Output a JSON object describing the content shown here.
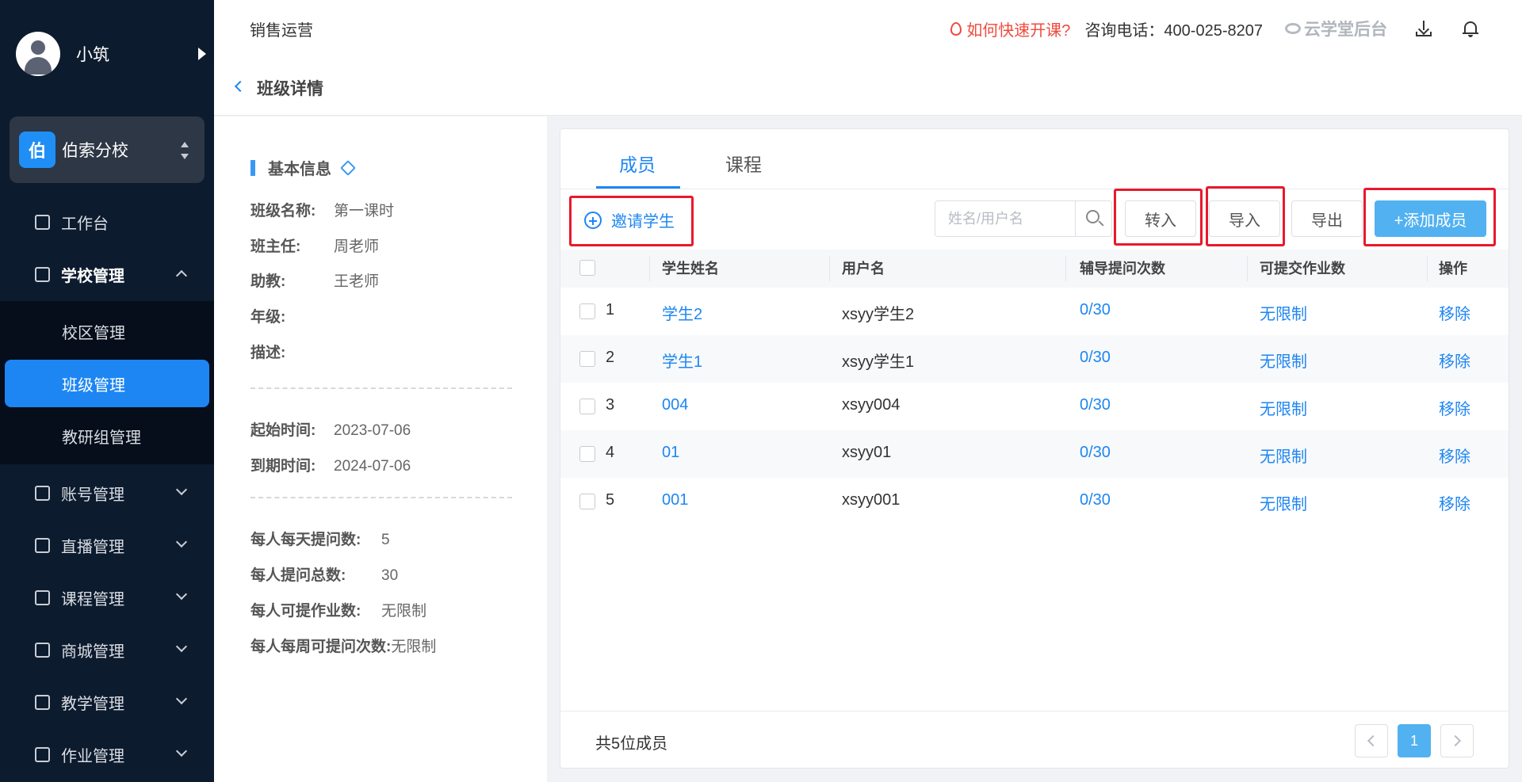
{
  "sidebar": {
    "user_name": "小筑",
    "school_badge": "伯",
    "school_name": "伯索分校",
    "items": [
      {
        "label": "工作台"
      },
      {
        "label": "学校管理"
      },
      {
        "label": "账号管理"
      },
      {
        "label": "直播管理"
      },
      {
        "label": "课程管理"
      },
      {
        "label": "商城管理"
      },
      {
        "label": "教学管理"
      },
      {
        "label": "作业管理"
      }
    ],
    "sub_items": [
      {
        "label": "校区管理"
      },
      {
        "label": "班级管理"
      },
      {
        "label": "教研组管理"
      }
    ],
    "selected_sub": "班级管理"
  },
  "header": {
    "title": "销售运营",
    "help_link": "如何快速开课?",
    "hotline": "咨询电话：400-025-8207",
    "brand": "云学堂后台"
  },
  "breadcrumb": {
    "title": "班级详情"
  },
  "info": {
    "section_title": "基本信息",
    "rows": [
      {
        "label": "班级名称:",
        "value": "第一课时"
      },
      {
        "label": "班主任:",
        "value": "周老师"
      },
      {
        "label": "助教:",
        "value": "王老师"
      },
      {
        "label": "年级:",
        "value": ""
      },
      {
        "label": "描述:",
        "value": ""
      }
    ],
    "dates": [
      {
        "label": "起始时间:",
        "value": "2023-07-06"
      },
      {
        "label": "到期时间:",
        "value": "2024-07-06"
      }
    ],
    "limits": [
      {
        "label": "每人每天提问数:",
        "value": "5"
      },
      {
        "label": "每人提问总数:",
        "value": "30"
      },
      {
        "label": "每人可提作业数:",
        "value": "无限制"
      },
      {
        "label": "每人每周可提问次数:",
        "value": "无限制"
      }
    ]
  },
  "main": {
    "tabs": [
      {
        "label": "成员"
      },
      {
        "label": "课程"
      }
    ],
    "active_tab": "成员",
    "invite_label": "邀请学生",
    "search_placeholder": "姓名/用户名",
    "buttons": {
      "transfer": "转入",
      "import": "导入",
      "export": "导出",
      "add_member": "+添加成员"
    },
    "columns": [
      "学生姓名",
      "用户名",
      "辅导提问次数",
      "可提交作业数",
      "操作"
    ],
    "rows": [
      {
        "index": "1",
        "name": "学生2",
        "username": "xsyy学生2",
        "questions": "0/30",
        "homework": "无限制",
        "action": "移除"
      },
      {
        "index": "2",
        "name": "学生1",
        "username": "xsyy学生1",
        "questions": "0/30",
        "homework": "无限制",
        "action": "移除"
      },
      {
        "index": "3",
        "name": "004",
        "username": "xsyy004",
        "questions": "0/30",
        "homework": "无限制",
        "action": "移除"
      },
      {
        "index": "4",
        "name": "01",
        "username": "xsyy01",
        "questions": "0/30",
        "homework": "无限制",
        "action": "移除"
      },
      {
        "index": "5",
        "name": "001",
        "username": "xsyy001",
        "questions": "0/30",
        "homework": "无限制",
        "action": "移除"
      }
    ],
    "total_label": "共5位成员",
    "current_page": "1"
  },
  "colors": {
    "accent": "#1d86f3",
    "sidebar_bg": "#0d1b2e",
    "highlight": "#e8192c",
    "warning": "#f04a3c"
  }
}
